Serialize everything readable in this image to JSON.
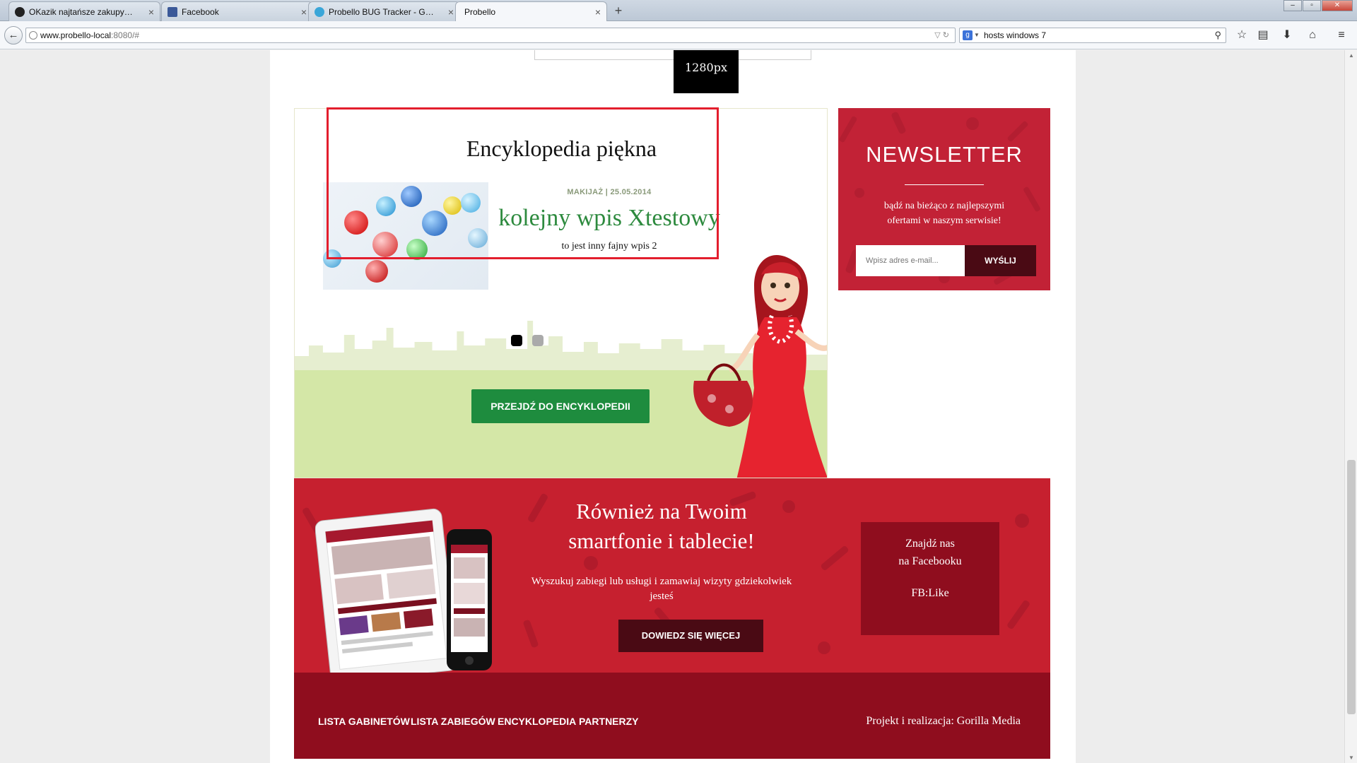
{
  "browser": {
    "tabs": [
      {
        "label": "OKazik najtańsze zakupy gr...",
        "favicon": "okazik-icon",
        "active": false
      },
      {
        "label": "Facebook",
        "favicon": "facebook-icon",
        "active": false
      },
      {
        "label": "Probello BUG Tracker - Gor...",
        "favicon": "bugtracker-icon",
        "active": false
      },
      {
        "label": "Probello",
        "favicon": "probello-icon",
        "active": true
      }
    ],
    "close_glyph": "×",
    "new_tab_glyph": "+",
    "window_buttons": {
      "minimize": "‒",
      "maximize": "▫",
      "close": "✕"
    },
    "back_glyph": "←",
    "url_host": "www.probello-local",
    "url_rest": ":8080/#",
    "url_controls": "▽ ↻",
    "search_engine_label": "g",
    "search_text": "hosts windows 7",
    "search_go": "⚲",
    "toolbar_icons": [
      "star-icon",
      "bookmarks-icon",
      "download-icon",
      "home-icon",
      "menu-icon"
    ]
  },
  "page": {
    "width_badge": "1280px",
    "encyclopedia": {
      "title": "Encyklopedia piękna",
      "meta": "MAKIJAŻ | 25.05.2014",
      "post_title": "kolejny wpis Xtestowy",
      "excerpt": "to jest inny fajny wpis 2",
      "slide_count": 2,
      "active_slide": 1,
      "cta": "PRZEJDŹ DO ENCYKLOPEDII"
    },
    "newsletter": {
      "title": "NEWSLETTER",
      "text": "bądź na bieżąco z najlepszymi ofertami w naszym serwisie!",
      "input_placeholder": "Wpisz adres e-mail...",
      "button": "WYŚLIJ"
    },
    "promo": {
      "title_line1": "Również na Twoim",
      "title_line2": "smartfonie i tablecie!",
      "text": "Wyszukuj zabiegi lub usługi i zamawiaj wizyty gdziekolwiek jesteś",
      "button": "DOWIEDZ SIĘ WIĘCEJ",
      "facebook_line1": "Znajdź nas",
      "facebook_line2": "na Facebooku",
      "facebook_like": "FB:Like"
    },
    "footer": {
      "links": [
        "LISTA GABINETÓW",
        "LISTA ZABIEGÓW",
        "ENCYKLOPEDIA",
        "PARTNERZY"
      ],
      "credit": "Projekt i realizacja: Gorilla Media"
    }
  },
  "colors": {
    "brand_red": "#c6202f",
    "dark_red": "#8f0d1e",
    "button_dark": "#4a0a14",
    "green": "#1e8c3e",
    "highlight": "#e31e2d"
  }
}
